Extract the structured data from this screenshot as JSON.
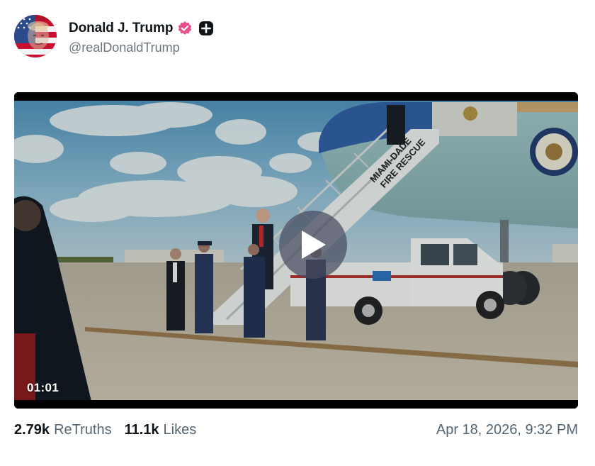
{
  "author": {
    "display_name": "Donald J. Trump",
    "handle": "@realDonaldTrump",
    "avatar_icon": "flag-portrait-avatar",
    "verified_icon": "verified-badge-icon",
    "verified_color": "#e84f8c",
    "extra_badge_icon": "plus-badge-icon"
  },
  "video": {
    "duration": "01:01",
    "play_icon": "play-icon",
    "stair_text_line1": "MIAMI-DADE",
    "stair_text_line2": "FIRE RESCUE"
  },
  "stats": {
    "retruths_count": "2.79k",
    "retruths_label": "ReTruths",
    "likes_count": "11.1k",
    "likes_label": "Likes"
  },
  "timestamp": "Apr 18, 2026, 9:32 PM"
}
